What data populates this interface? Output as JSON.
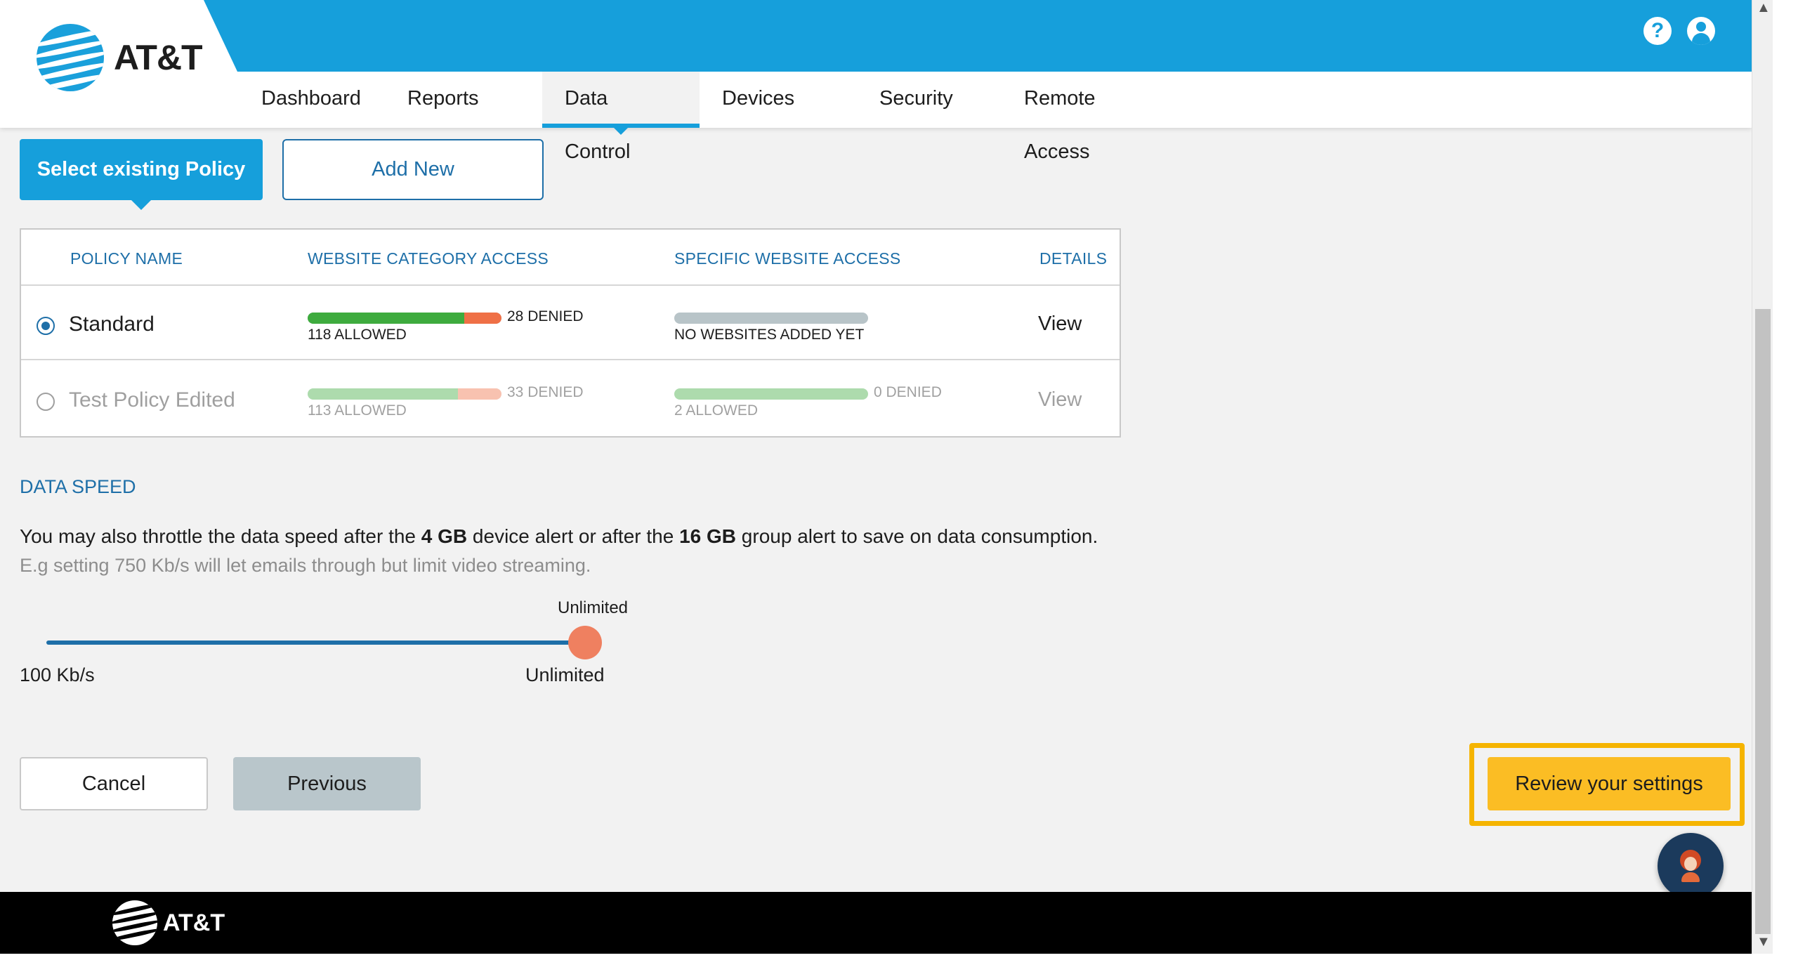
{
  "header": {
    "logo_text": "AT&T",
    "help_icon": "?",
    "tabs": [
      {
        "label": "Dashboard",
        "active": false
      },
      {
        "label": "Reports",
        "active": false
      },
      {
        "label": "Data Control",
        "active": true
      },
      {
        "label": "Devices",
        "active": false
      },
      {
        "label": "Security",
        "active": false
      },
      {
        "label": "Remote Access",
        "active": false
      }
    ]
  },
  "policy_tabs": {
    "select_existing": "Select existing Policy",
    "add_new": "Add New"
  },
  "policy_table": {
    "headers": [
      "POLICY NAME",
      "WEBSITE CATEGORY ACCESS",
      "SPECIFIC WEBSITE ACCESS",
      "DETAILS"
    ],
    "rows": [
      {
        "name": "Standard",
        "selected": true,
        "category_denied": "28 DENIED",
        "category_allowed": "118 ALLOWED",
        "category_allowed_count": 118,
        "category_denied_count": 28,
        "specific_denied": "",
        "specific_allowed": "NO WEBSITES ADDED YET",
        "specific_allowed_count": 0,
        "specific_denied_count": 0,
        "details": "View"
      },
      {
        "name": "Test Policy Edited",
        "selected": false,
        "category_denied": "33 DENIED",
        "category_allowed": "113 ALLOWED",
        "category_allowed_count": 113,
        "category_denied_count": 33,
        "specific_denied": "0 DENIED",
        "specific_allowed": "2 ALLOWED",
        "specific_allowed_count": 2,
        "specific_denied_count": 0,
        "details": "View"
      }
    ]
  },
  "data_speed": {
    "title": "DATA SPEED",
    "text_1": "You may also throttle the data speed after the ",
    "device_alert": "4 GB",
    "text_2": " device alert or after the ",
    "group_alert": "16 GB",
    "text_3": " group alert to save on data consumption.",
    "hint": "E.g setting 750 Kb/s will let emails through but limit video streaming.",
    "slider_value": "Unlimited",
    "slider_min": "100 Kb/s",
    "slider_max": "Unlimited",
    "slider_level": 1.0
  },
  "actions": {
    "cancel": "Cancel",
    "previous": "Previous",
    "review": "Review your settings"
  },
  "footer": {
    "logo_text": "AT&T"
  },
  "colors": {
    "brand_blue": "#169fdb",
    "link_blue": "#1e6fa8",
    "allowed_green": "#3eab3e",
    "denied_orange": "#ef7046",
    "highlight_yellow": "#fbbd24"
  }
}
